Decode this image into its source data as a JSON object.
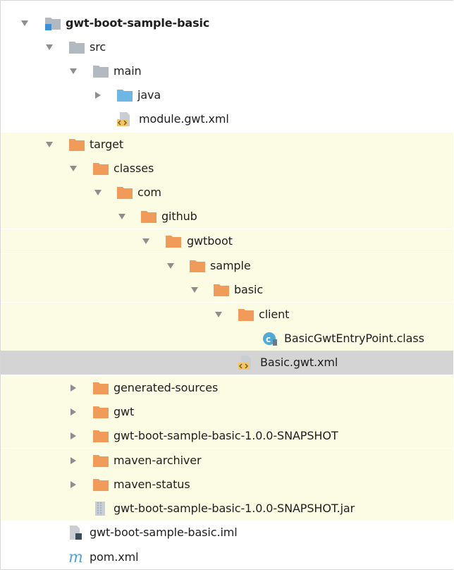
{
  "colors": {
    "excluded_background": "#fcfce4",
    "selected_background": "#d4d4d4",
    "folder_gray": "#b3b9c1",
    "folder_blue": "#6eb7e4",
    "folder_orange": "#f19b5b",
    "class_icon": "#51a9d6"
  },
  "tree": [
    {
      "label": "gwt-boot-sample-basic",
      "icon": "module-folder-icon",
      "expanded": true
    },
    {
      "label": "src",
      "icon": "folder-icon",
      "expanded": true
    },
    {
      "label": "main",
      "icon": "folder-icon",
      "expanded": true
    },
    {
      "label": "java",
      "icon": "source-folder-icon",
      "expanded": false
    },
    {
      "label": "module.gwt.xml",
      "icon": "xml-file-icon"
    },
    {
      "label": "target",
      "icon": "excluded-folder-icon",
      "expanded": true
    },
    {
      "label": "classes",
      "icon": "excluded-folder-icon",
      "expanded": true
    },
    {
      "label": "com",
      "icon": "excluded-folder-icon",
      "expanded": true
    },
    {
      "label": "github",
      "icon": "excluded-folder-icon",
      "expanded": true
    },
    {
      "label": "gwtboot",
      "icon": "excluded-folder-icon",
      "expanded": true
    },
    {
      "label": "sample",
      "icon": "excluded-folder-icon",
      "expanded": true
    },
    {
      "label": "basic",
      "icon": "excluded-folder-icon",
      "expanded": true
    },
    {
      "label": "client",
      "icon": "excluded-folder-icon",
      "expanded": true
    },
    {
      "label": "BasicGwtEntryPoint.class",
      "icon": "class-file-icon"
    },
    {
      "label": "Basic.gwt.xml",
      "icon": "xml-file-icon",
      "selected": true
    },
    {
      "label": "generated-sources",
      "icon": "excluded-folder-icon",
      "expanded": false
    },
    {
      "label": "gwt",
      "icon": "excluded-folder-icon",
      "expanded": false
    },
    {
      "label": "gwt-boot-sample-basic-1.0.0-SNAPSHOT",
      "icon": "excluded-folder-icon",
      "expanded": false
    },
    {
      "label": "maven-archiver",
      "icon": "excluded-folder-icon",
      "expanded": false
    },
    {
      "label": "maven-status",
      "icon": "excluded-folder-icon",
      "expanded": false
    },
    {
      "label": "gwt-boot-sample-basic-1.0.0-SNAPSHOT.jar",
      "icon": "jar-archive-icon"
    },
    {
      "label": "gwt-boot-sample-basic.iml",
      "icon": "iml-file-icon"
    },
    {
      "label": "pom.xml",
      "icon": "maven-pom-icon"
    }
  ]
}
